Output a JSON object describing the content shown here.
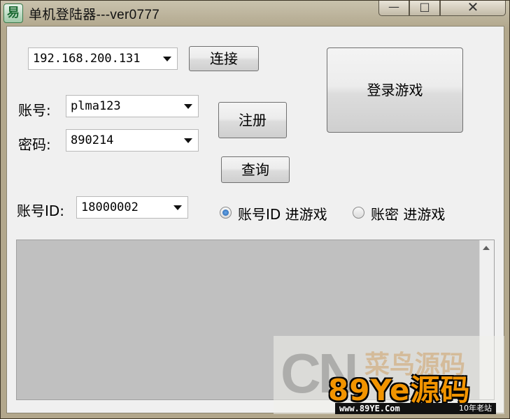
{
  "window": {
    "title": "单机登陆器---ver0777",
    "icon": "易",
    "controls": {
      "minimize": "—",
      "maximize": "□",
      "close": "✕"
    }
  },
  "server": {
    "value": "192.168.200.131"
  },
  "buttons": {
    "connect": "连接",
    "register": "注册",
    "query": "查询",
    "login": "登录游戏"
  },
  "account": {
    "label": "账号:",
    "value": "plma123"
  },
  "password": {
    "label": "密码:",
    "value": "890214"
  },
  "account_id": {
    "label": "账号ID:",
    "value": "18000002"
  },
  "radio": {
    "by_id": {
      "label": "账号ID 进游戏",
      "checked": true
    },
    "by_password": {
      "label": "账密 进游戏",
      "checked": false
    }
  },
  "watermark": {
    "cn": "CN",
    "top": "菜鸟源码",
    "brand": "89Ye源码",
    "url": "www.89YE.Com",
    "tag": "10年老站"
  }
}
